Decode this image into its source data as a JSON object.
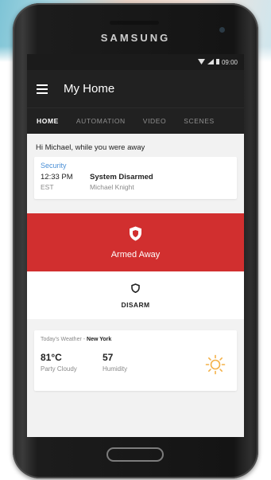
{
  "device": {
    "brand": "SAMSUNG"
  },
  "status_bar": {
    "time": "09:00",
    "icons": [
      "wifi-icon",
      "signal-icon",
      "battery-icon"
    ]
  },
  "app_bar": {
    "title": "My Home",
    "menu_icon": "hamburger-menu-icon"
  },
  "tabs": [
    {
      "label": "HOME",
      "active": true
    },
    {
      "label": "AUTOMATION",
      "active": false
    },
    {
      "label": "VIDEO",
      "active": false
    },
    {
      "label": "SCENES",
      "active": false
    }
  ],
  "greeting": "Hi Michael, while you were away",
  "security": {
    "heading": "Security",
    "time": "12:33 PM",
    "timezone": "EST",
    "status": "System Disarmed",
    "user": "Michael Knight"
  },
  "alarm": {
    "state_label": "Armed Away",
    "state_icon": "shield-icon",
    "action_label": "DISARM",
    "action_icon": "shield-outline-icon",
    "color": "#d12f2f"
  },
  "weather": {
    "prefix": "Today's Weather - ",
    "location": "New York",
    "temperature": "81°C",
    "condition": "Party Cloudy",
    "humidity": "57",
    "humidity_label": "Humidity",
    "icon": "sun-icon"
  },
  "colors": {
    "accent_blue": "#4a8fd6",
    "app_bar": "#212121",
    "sun": "#f4b046"
  }
}
